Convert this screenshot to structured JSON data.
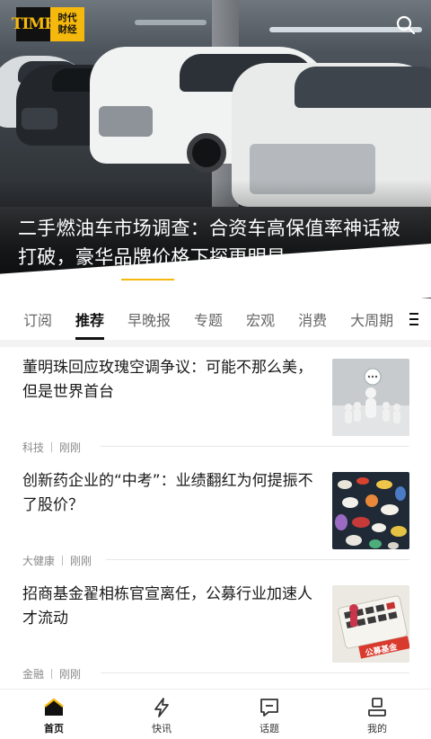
{
  "header": {
    "logo_text": "TIME",
    "logo_cn_line1": "时代",
    "logo_cn_line2": "财经",
    "search_icon": "search-icon"
  },
  "hero": {
    "title": "二手燃油车市场调查：合资车高保值率神话被打破，豪华品牌价格下探更明显",
    "carousel_position": 0.18,
    "accent_color": "#f5b80c"
  },
  "tabs": [
    {
      "label": "订阅"
    },
    {
      "label": "推荐",
      "active": true
    },
    {
      "label": "早晚报"
    },
    {
      "label": "专题"
    },
    {
      "label": "宏观"
    },
    {
      "label": "消费"
    },
    {
      "label": "大周期"
    }
  ],
  "tab_menu_icon": "menu-icon",
  "feed": [
    {
      "title": "董明珠回应玫瑰空调争议：可能不那么美，但是世界首台",
      "category": "科技",
      "time": "刚刚",
      "thumb": "figurines-image"
    },
    {
      "title": "创新药企业的“中考”：业绩翻红为何提振不了股价？",
      "category": "大健康",
      "time": "刚刚",
      "thumb": "pills-image"
    },
    {
      "title": "招商基金翟相栋官宣离任，公募行业加速人才流动",
      "category": "金融",
      "time": "刚刚",
      "thumb": "calculator-image"
    }
  ],
  "bottom_nav": [
    {
      "label": "首页",
      "icon": "home-icon",
      "active": true
    },
    {
      "label": "快讯",
      "icon": "lightning-icon"
    },
    {
      "label": "话题",
      "icon": "topic-icon"
    },
    {
      "label": "我的",
      "icon": "profile-icon"
    }
  ]
}
